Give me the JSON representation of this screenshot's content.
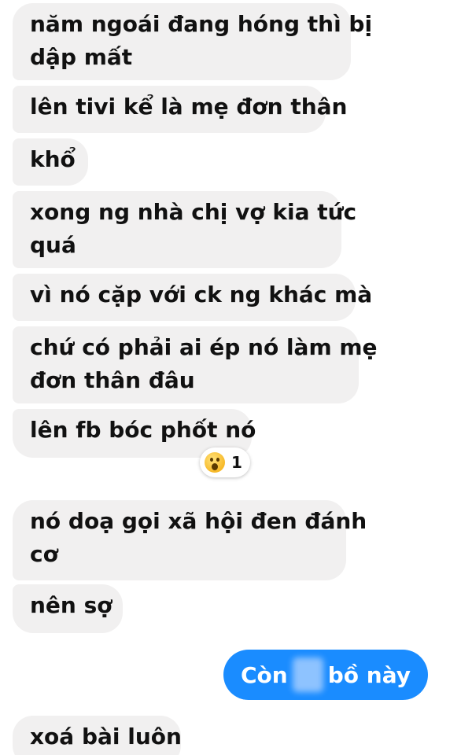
{
  "messages": [
    {
      "lines": [
        "năm ngoái đang hóng thì bị",
        "dập mất"
      ]
    },
    {
      "lines": [
        "lên tivi kể là mẹ đơn thân"
      ]
    },
    {
      "lines": [
        "khổ"
      ]
    },
    {
      "lines": [
        "xong ng nhà chị vợ kia tức",
        "quá"
      ]
    },
    {
      "lines": [
        "vì nó cặp với ck ng khác mà"
      ]
    },
    {
      "lines": [
        "chứ có phải ai ép nó làm mẹ",
        "đơn thân đâu"
      ]
    },
    {
      "lines": [
        "lên fb bóc phốt nó"
      ]
    },
    {
      "lines": [
        "nó doạ gọi xã hội đen đánh",
        "cơ"
      ]
    },
    {
      "lines": [
        "nên sợ"
      ]
    },
    {
      "lines": [
        "xoá bài luôn"
      ]
    }
  ],
  "reaction": {
    "icon": "wow-emoji-icon",
    "count": "1"
  },
  "outgoing": {
    "before": "Còn",
    "after": "bồ này"
  },
  "colors": {
    "incoming_bg": "#f1f0f0",
    "outgoing_bg": "#1a8cff",
    "text": "#111111"
  }
}
